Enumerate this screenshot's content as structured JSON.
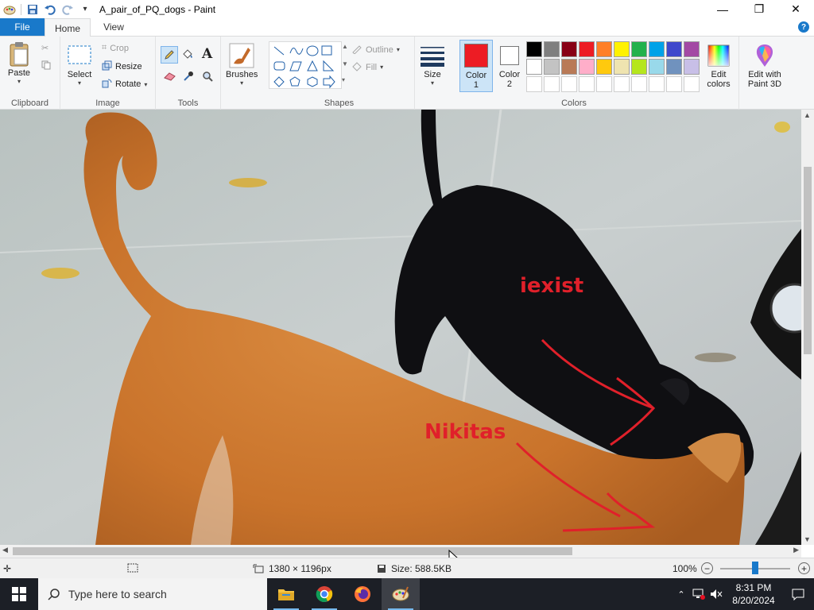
{
  "window": {
    "title": "A_pair_of_PQ_dogs - Paint",
    "controls": [
      "—",
      "❐",
      "✕"
    ]
  },
  "tabs": {
    "file": "File",
    "items": [
      {
        "label": "Home",
        "active": true
      },
      {
        "label": "View",
        "active": false
      }
    ],
    "help": "?"
  },
  "ribbon": {
    "clipboard": {
      "group": "Clipboard",
      "paste": "Paste"
    },
    "image": {
      "group": "Image",
      "select": "Select",
      "crop": "Crop",
      "resize": "Resize",
      "rotate": "Rotate"
    },
    "tools": {
      "group": "Tools",
      "brushes": "Brushes"
    },
    "shapes": {
      "group": "Shapes",
      "outline": "Outline",
      "fill": "Fill",
      "size": "Size"
    },
    "colors": {
      "group": "Colors",
      "color1": "Color\n1",
      "color2": "Color\n2",
      "color1_value": "#ed1c24",
      "color2_value": "#ffffff",
      "edit_colors": "Edit colors",
      "edit_paint3d": "Edit with Paint 3D",
      "palette": [
        "#000000",
        "#7f7f7f",
        "#880015",
        "#ed1c24",
        "#ff7f27",
        "#fff200",
        "#22b14c",
        "#00a2e8",
        "#3f48cc",
        "#a349a4",
        "#ffffff",
        "#c3c3c3",
        "#b97a57",
        "#ffaec9",
        "#ffc90e",
        "#efe4b0",
        "#b5e61d",
        "#99d9ea",
        "#7092be",
        "#c8bfe7",
        "#ffffff",
        "#ffffff",
        "#ffffff",
        "#ffffff",
        "#ffffff",
        "#ffffff",
        "#ffffff",
        "#ffffff",
        "#ffffff",
        "#ffffff"
      ]
    }
  },
  "canvas": {
    "annotations": [
      {
        "text": "iexist",
        "color": "#e0202a"
      },
      {
        "text": "Nikitas",
        "color": "#e0202a"
      }
    ]
  },
  "status": {
    "dimensions": "1380 × 1196px",
    "size": "Size: 588.5KB",
    "zoom": "100%"
  },
  "taskbar": {
    "search_placeholder": "Type here to search",
    "time": "8:31 PM",
    "date": "8/20/2024"
  }
}
